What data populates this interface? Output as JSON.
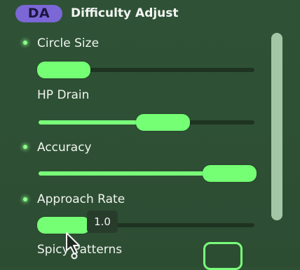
{
  "mod": {
    "acronym": "DA",
    "title": "Difficulty Adjust",
    "badge_color": "#7b67d6"
  },
  "settings": [
    {
      "label": "Circle Size",
      "value": 0.08,
      "active": true
    },
    {
      "label": "HP Drain",
      "value": 0.48,
      "active": false
    },
    {
      "label": "Accuracy",
      "value": 0.94,
      "active": true
    },
    {
      "label": "Approach Rate",
      "value": 0.22,
      "active": true
    }
  ],
  "tooltip": {
    "text": "1.0"
  },
  "partial_setting": {
    "label": "Spicy Patterns"
  },
  "accent_color": "#79ff79",
  "icons": {
    "active_indicator": "dot-icon",
    "cursor": "cursor-icon"
  }
}
